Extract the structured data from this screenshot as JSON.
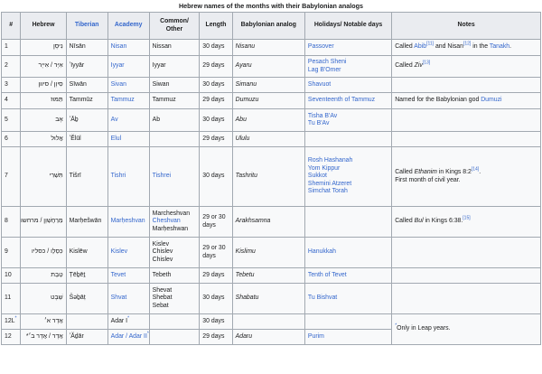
{
  "caption": "Hebrew names of the months with their Babylonian analogs",
  "columns": [
    "#",
    "Hebrew",
    "Tiberian",
    "Academy",
    "Common/ Other",
    "Length",
    "Babylonian analog",
    "Holidays/ Notable days",
    "Notes"
  ],
  "rows": [
    {
      "num": "1",
      "hebrew": "נִיסָן",
      "tiberian": "Nīsān",
      "academy": "Nisan",
      "common": [
        "Nissan"
      ],
      "length": "30 days",
      "babylonian": "Nisanu",
      "holidays": [
        "Passover"
      ],
      "notes": [
        [
          "Called ",
          "Abib",
          "[11]",
          " and Nisan",
          "[12]",
          " in the ",
          "Tanakh",
          "."
        ]
      ]
    },
    {
      "num": "2",
      "hebrew": "אִיָּר / אִייָר",
      "tiberian": "ʼIyyār",
      "academy": "Iyyar",
      "common": [
        "Iyyar"
      ],
      "length": "29 days",
      "babylonian": "Ayaru",
      "holidays": [
        "Pesach Sheni",
        "Lag B'Omer"
      ],
      "notes": [
        [
          "Called ",
          "Ziv",
          "[13]"
        ]
      ]
    },
    {
      "num": "3",
      "hebrew": "סִיוָן / סיוון",
      "tiberian": "Sīwān",
      "academy": "Sivan",
      "common": [
        "Siwan"
      ],
      "length": "30 days",
      "babylonian": "Simanu",
      "holidays": [
        "Shavuot"
      ],
      "notes": []
    },
    {
      "num": "4",
      "hebrew": "תַּמּוּז",
      "tiberian": "Tammūz",
      "academy": "Tammuz",
      "common": [
        "Tammuz"
      ],
      "length": "29 days",
      "babylonian": "Dumuzu",
      "holidays": [
        "Seventeenth of Tammuz"
      ],
      "notes": [
        [
          "Named for the Babylonian god ",
          "Dumuzi"
        ]
      ]
    },
    {
      "num": "5",
      "hebrew": "אָב",
      "tiberian": "ʼĀḇ",
      "academy": "Av",
      "common": [
        "Ab"
      ],
      "length": "30 days",
      "babylonian": "Abu",
      "holidays": [
        "Tisha B'Av",
        "Tu B'Av"
      ],
      "notes": []
    },
    {
      "num": "6",
      "hebrew": "אֱלוּל",
      "tiberian": "ʼĔlūl",
      "academy": "Elul",
      "common": [],
      "length": "29 days",
      "babylonian": "Ululu",
      "holidays": [],
      "notes": []
    },
    {
      "num": "7",
      "hebrew": "תִּשְׁרִי",
      "tiberian": "Tišrī",
      "academy": "Tishri",
      "common": [
        "Tishrei"
      ],
      "length": "30 days",
      "babylonian": "Tashritu",
      "holidays": [
        "Rosh Hashanah",
        "Yom Kippur",
        "Sukkot",
        "Shemini Atzeret",
        "Simchat Torah"
      ],
      "notes": [
        [
          "Called ",
          "Ethanim",
          " in Kings 8:2",
          "[14]",
          "."
        ],
        [
          "First month of civil year."
        ]
      ]
    },
    {
      "num": "8",
      "hebrew": "מַרְחֶשְׁוָן / מרחשוון",
      "tiberian": "Marḥešwān",
      "academy": "Marḥeshvan",
      "common": [
        "Marcheshvan",
        "Cheshvan",
        "Marḥeshwan"
      ],
      "length": "29 or 30 days",
      "babylonian": "Arakhsamna",
      "holidays": [],
      "notes": [
        [
          "Called ",
          "Bul",
          " in Kings 6:38.",
          "[15]"
        ]
      ]
    },
    {
      "num": "9",
      "hebrew": "כִּסְלֵו / כסליו",
      "tiberian": "Kislēw",
      "academy": "Kislev",
      "common": [
        "Kislev",
        "Chislev",
        "Chislev"
      ],
      "length": "29 or 30 days",
      "babylonian": "Kislimu",
      "holidays": [
        "Hanukkah"
      ],
      "notes": []
    },
    {
      "num": "10",
      "hebrew": "טֵבֵת",
      "tiberian": "Ṭēḇēṯ",
      "academy": "Tevet",
      "common": [
        "Tebeth"
      ],
      "length": "29 days",
      "babylonian": "Tebetu",
      "holidays": [
        "Tenth of Tevet"
      ],
      "notes": []
    },
    {
      "num": "11",
      "hebrew": "שְׁבָט",
      "tiberian": "Šəḇāṭ",
      "academy": "Shvat",
      "common": [
        "Shevat",
        "Shebat",
        "Sebat"
      ],
      "length": "30 days",
      "babylonian": "Shabatu",
      "holidays": [
        "Tu Bishvat"
      ],
      "notes": []
    },
    {
      "num": "12L",
      "num_sup": "*",
      "hebrew": "אֲדָר א׳",
      "tiberian": "",
      "academy": "Adar I",
      "academy_sup": "*",
      "common": [],
      "length": "30 days",
      "babylonian": "",
      "holidays": [],
      "notes": []
    },
    {
      "num": "12",
      "hebrew": "אֲדָר / אֲדָר ב׳*",
      "tiberian": "ʼĂḏār",
      "academy": "Adar / Adar II",
      "academy_sup": "*",
      "common": [],
      "length": "29 days",
      "babylonian": "Adaru",
      "holidays": [
        "Purim"
      ],
      "notes": []
    }
  ],
  "leap_note": {
    "sup": "*",
    "text": "Only in Leap years."
  }
}
